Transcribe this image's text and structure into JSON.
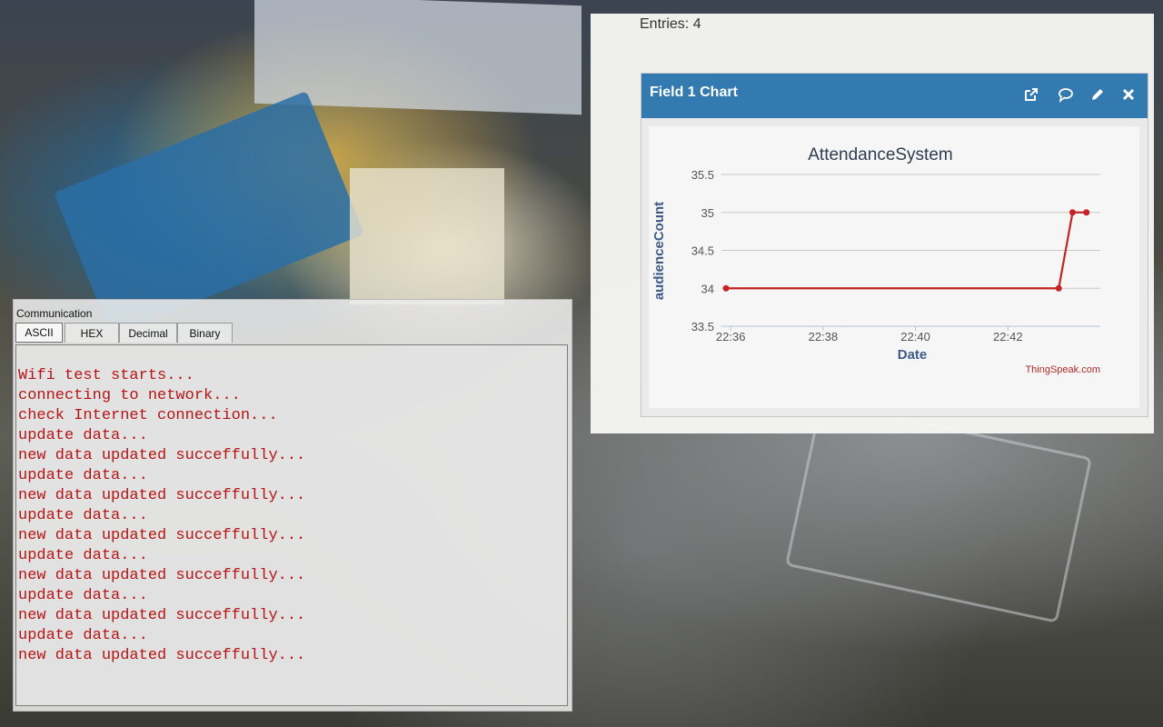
{
  "communication": {
    "title": "Communication",
    "tabs": [
      "ASCII",
      "HEX",
      "Decimal",
      "Binary"
    ],
    "active_tab": "ASCII",
    "log_color": "#b51515",
    "lines": [
      "Wifi test starts...",
      "connecting to network...",
      "check Internet connection...",
      "update data...",
      "new data updated succeffully...",
      "update data...",
      "new data updated succeffully...",
      "update data...",
      "new data updated succeffully...",
      "update data...",
      "new data updated succeffully...",
      "update data...",
      "new data updated succeffully...",
      "update data...",
      "new data updated succeffully..."
    ]
  },
  "thingspeak": {
    "entries_label": "Entries: 4",
    "widget_title": "Field 1 Chart",
    "header_color": "#337ab0",
    "icons": [
      "external-link-icon",
      "comment-icon",
      "pencil-icon",
      "close-icon"
    ],
    "watermark": "ThingSpeak.com"
  },
  "chart_data": {
    "type": "line",
    "title": "AttendanceSystem",
    "xlabel": "Date",
    "ylabel": "audienceCount",
    "x_ticks": [
      "22:36",
      "22:38",
      "22:40",
      "22:42"
    ],
    "y_ticks": [
      "33.5",
      "34",
      "34.5",
      "35",
      "35.5"
    ],
    "xlim_minutes": [
      "22:35.8",
      "22:44.0"
    ],
    "ylim": [
      33.5,
      35.5
    ],
    "series": [
      {
        "color": "#c42424",
        "points": [
          {
            "x": "22:35.9",
            "y": 34
          },
          {
            "x": "22:43.1",
            "y": 34
          },
          {
            "x": "22:43.4",
            "y": 35
          },
          {
            "x": "22:43.7",
            "y": 35
          }
        ]
      }
    ],
    "grid": true
  }
}
